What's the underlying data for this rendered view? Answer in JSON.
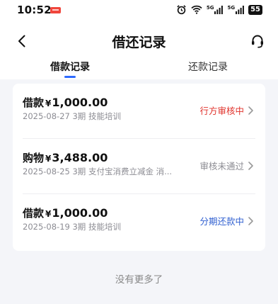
{
  "statusbar": {
    "time": "10:52",
    "signal1": "5G",
    "signal2": "5G",
    "battery": "55"
  },
  "navbar": {
    "title": "借还记录"
  },
  "tabs": [
    {
      "label": "借款记录",
      "active": true
    },
    {
      "label": "还款记录",
      "active": false
    }
  ],
  "records": [
    {
      "type": "借款",
      "yen": "¥",
      "amount": "1,000.00",
      "subtitle": "2025-08-27 3期  技能培训",
      "status": "行方审核中",
      "status_color": "#e0322b"
    },
    {
      "type": "购物",
      "yen": "¥",
      "amount": "3,488.00",
      "subtitle": "2025-08-25 3期  支付宝消费立减金 消...",
      "status": "审核未通过",
      "status_color": "#8c8c93"
    },
    {
      "type": "借款",
      "yen": "¥",
      "amount": "1,000.00",
      "subtitle": "2025-08-19 3期  技能培训",
      "status": "分期还款中",
      "status_color": "#2f5fd0"
    }
  ],
  "footer": {
    "text": "没有更多了"
  },
  "colors": {
    "accent": "#2f6bff",
    "background": "#f4f5f9"
  }
}
